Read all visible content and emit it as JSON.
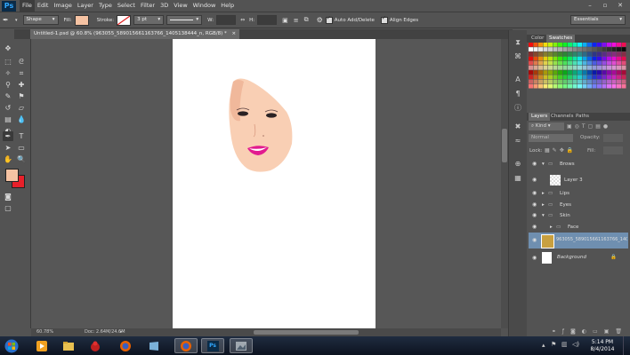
{
  "app": {
    "logo": "Ps"
  },
  "menu": [
    "File",
    "Edit",
    "Image",
    "Layer",
    "Type",
    "Select",
    "Filter",
    "3D",
    "View",
    "Window",
    "Help"
  ],
  "options": {
    "mode": "Shape",
    "fill_label": "Fill:",
    "stroke_label": "Stroke:",
    "stroke_size": "3 pt",
    "w_label": "W:",
    "h_label": "H:",
    "auto_add_delete": "Auto Add/Delete",
    "align_edges": "Align Edges",
    "workspace": "Essentials",
    "fill_color": "#f6c3a3"
  },
  "document": {
    "tab": "Untitled-1.psd @ 60.8% (963055_589015661163766_1405138444_n, RGB/8) *",
    "zoom": "60.78%",
    "doc_info": "Doc: 2.64M/24.6M"
  },
  "colors": {
    "foreground": "#f6c3a3",
    "background": "#e8202a",
    "accent": "#31a8ff"
  },
  "panels": {
    "color_tabs": [
      "Color",
      "Swatches"
    ],
    "layer_tabs": [
      "Layers",
      "Channels",
      "Paths"
    ],
    "kind": "Kind",
    "blend_mode": "Normal",
    "opacity_label": "Opacity:",
    "lock_label": "Lock:",
    "fill_label": "Fill:"
  },
  "layers": [
    {
      "name": "Brows",
      "type": "group",
      "indent": 0
    },
    {
      "name": "Layer 3",
      "type": "layer",
      "indent": 1
    },
    {
      "name": "Lips",
      "type": "group",
      "indent": 0
    },
    {
      "name": "Eyes",
      "type": "group",
      "indent": 0
    },
    {
      "name": "Skin",
      "type": "group",
      "indent": 0
    },
    {
      "name": "Face",
      "type": "group",
      "indent": 1
    },
    {
      "name": "963055_589015661163766_1405138444_n",
      "type": "image",
      "indent": 0
    },
    {
      "name": "Background",
      "type": "background",
      "indent": 0
    }
  ],
  "taskbar": {
    "time": "5:14 PM",
    "date": "8/4/2014"
  }
}
